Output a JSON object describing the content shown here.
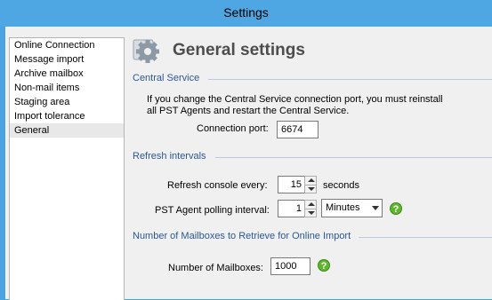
{
  "window": {
    "title": "Settings"
  },
  "nav": {
    "items": [
      {
        "label": "Online Connection"
      },
      {
        "label": "Message import"
      },
      {
        "label": "Archive mailbox"
      },
      {
        "label": "Non-mail items"
      },
      {
        "label": "Staging area"
      },
      {
        "label": "Import tolerance"
      },
      {
        "label": "General",
        "selected": true
      }
    ]
  },
  "header": {
    "title": "General settings",
    "icon": "gear-icon"
  },
  "central_service": {
    "heading": "Central Service",
    "description_line1": "If you change the Central Service connection port, you must reinstall",
    "description_line2": "all PST Agents and restart the Central Service.",
    "port_label": "Connection port:",
    "port_value": "6674"
  },
  "refresh": {
    "heading": "Refresh intervals",
    "console_label": "Refresh console every:",
    "console_value": "15",
    "console_unit": "seconds",
    "polling_label": "PST Agent polling interval:",
    "polling_value": "1",
    "polling_unit": "Minutes"
  },
  "mailboxes": {
    "heading": "Number of Mailboxes to Retrieve for Online Import",
    "count_label": "Number of Mailboxes:",
    "count_value": "1000"
  },
  "colors": {
    "titlebar": "#4ea6e2",
    "section_heading": "#2b5797",
    "help": "#5cb82a"
  }
}
